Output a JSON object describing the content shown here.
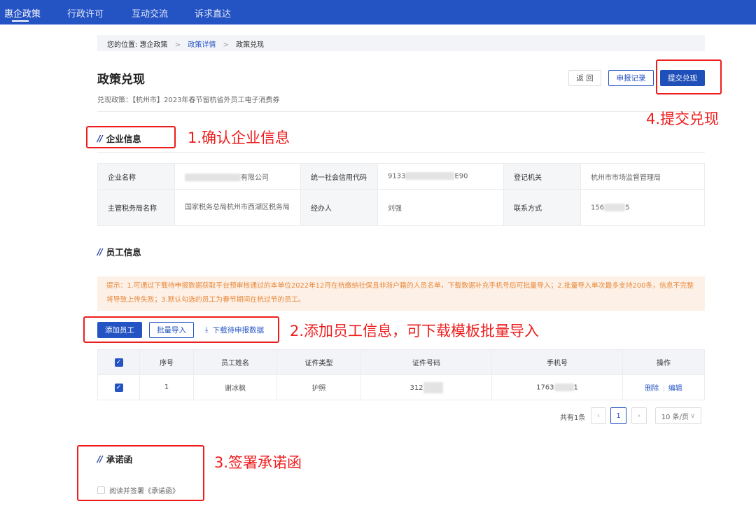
{
  "nav": {
    "items": [
      "惠企政策",
      "行政许可",
      "互动交流",
      "诉求直达"
    ],
    "active": 0
  },
  "breadcrumb": {
    "prefix": "您的位置:",
    "items": [
      "惠企政策",
      "政策详情",
      "政策兑现"
    ],
    "separator": ">"
  },
  "page": {
    "title": "政策兑现",
    "subtitle": "兑现政策：【杭州市】2023年春节留杭省外员工电子消费券"
  },
  "actions": {
    "back": "返 回",
    "records": "申报记录",
    "submit": "提交兑现"
  },
  "company": {
    "title": "企业信息",
    "fields": [
      {
        "label": "企业名称",
        "value": "有限公司"
      },
      {
        "label": "统一社会信用代码",
        "value_prefix": "9133",
        "value_suffix": "E90"
      },
      {
        "label": "登记机关",
        "value": "杭州市市场监督管理局"
      },
      {
        "label": "主管税务局名称",
        "value": "国家税务总局杭州市西湖区税务局"
      },
      {
        "label": "经办人",
        "value": "刘强"
      },
      {
        "label": "联系方式",
        "value_prefix": "156",
        "value_suffix": "5"
      }
    ]
  },
  "employees": {
    "title": "员工信息",
    "notice": "提示：1.可通过下载待申报数据获取平台预审核通过的本单位2022年12月在杭缴纳社保且非浙户籍的人员名单，下载数据补充手机号后可批量导入；2.批量导入单次最多支持200条，信息不完整将导致上传失败；3.默认勾选的员工为春节期间在杭过节的员工。",
    "add": "添加员工",
    "import": "批量导入",
    "download": "下载待申报数据",
    "columns": [
      "序号",
      "员工姓名",
      "证件类型",
      "证件号码",
      "手机号",
      "操作"
    ],
    "rows": [
      {
        "no": "1",
        "name": "谢冰枫",
        "id_type": "护照",
        "id_prefix": "312",
        "phone_prefix": "1763",
        "phone_suffix": "1",
        "delete": "删除",
        "edit": "编辑",
        "checked": true
      }
    ],
    "pagination": {
      "total": "共有1条",
      "current": "1",
      "page_size": "10 条/页"
    }
  },
  "promise": {
    "title": "承诺函",
    "checkbox": "阅读并签署《承诺函》"
  },
  "annotations": [
    "1.确认企业信息",
    "2.添加员工信息，可下载模板批量导入",
    "3.签署承诺函",
    "4.提交兑现"
  ],
  "colors": {
    "primary": "#2453c4",
    "annotation": "#ee1c1c"
  }
}
